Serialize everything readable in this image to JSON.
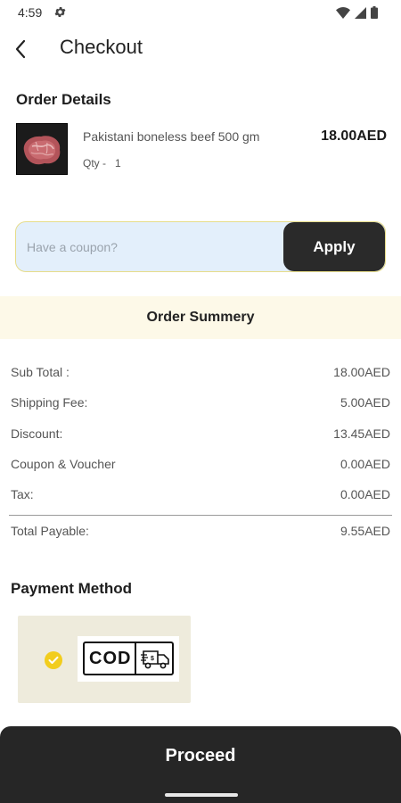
{
  "status_bar": {
    "time": "4:59",
    "icons": [
      "gear-icon",
      "wifi-icon",
      "signal-icon",
      "battery-icon"
    ]
  },
  "app_bar": {
    "back_icon": "chevron-left-icon",
    "title": "Checkout"
  },
  "order_details": {
    "title": "Order Details",
    "items": [
      {
        "name": "Pakistani boneless beef 500 gm",
        "qty_label": "Qty -",
        "qty": "1",
        "price": "18.00AED"
      }
    ]
  },
  "coupon": {
    "placeholder": "Have a coupon?",
    "value": "",
    "apply_label": "Apply"
  },
  "summary": {
    "title": "Order Summery",
    "rows": [
      {
        "label": "Sub Total :",
        "value": "18.00AED"
      },
      {
        "label": "Shipping Fee:",
        "value": "5.00AED"
      },
      {
        "label": "Discount:",
        "value": "13.45AED"
      },
      {
        "label": "Coupon & Voucher",
        "value": "0.00AED"
      },
      {
        "label": "Tax:",
        "value": "0.00AED"
      }
    ],
    "total": {
      "label": "Total Payable:",
      "value": "9.55AED"
    }
  },
  "payment": {
    "title": "Payment Method",
    "methods": [
      {
        "label": "COD",
        "selected": true,
        "icon": "delivery-truck-icon"
      }
    ]
  },
  "proceed": {
    "label": "Proceed"
  },
  "colors": {
    "accent_dark": "#262626",
    "coupon_bg": "#e3effb",
    "coupon_border": "#e6dc8a",
    "summary_header_bg": "#fdf9e8",
    "payment_card_bg": "#eeebdc",
    "check_yellow": "#f2cd1d"
  }
}
